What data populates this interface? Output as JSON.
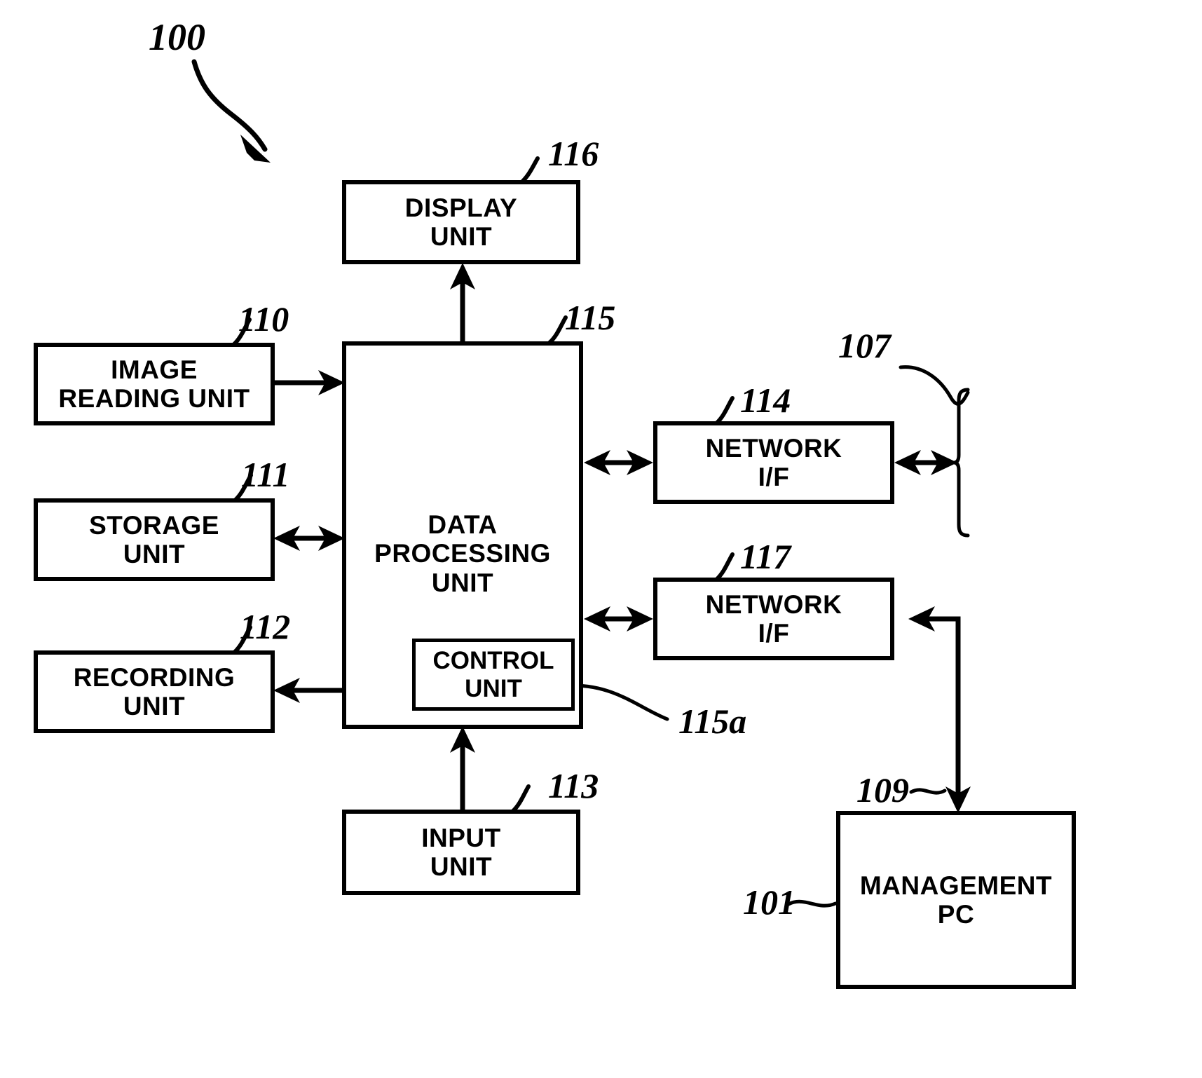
{
  "figure": {
    "type": "patent-block-diagram",
    "system_reference": "100",
    "boxes": [
      {
        "id": "display-unit",
        "label": "DISPLAY\nUNIT",
        "ref": "116"
      },
      {
        "id": "image-reading-unit",
        "label": "IMAGE\nREADING UNIT",
        "ref": "110"
      },
      {
        "id": "storage-unit",
        "label": "STORAGE\nUNIT",
        "ref": "111"
      },
      {
        "id": "recording-unit",
        "label": "RECORDING\nUNIT",
        "ref": "112"
      },
      {
        "id": "input-unit",
        "label": "INPUT\nUNIT",
        "ref": "113"
      },
      {
        "id": "data-processing-unit",
        "label": "DATA\nPROCESSING\nUNIT",
        "ref": "115"
      },
      {
        "id": "control-unit",
        "label": "CONTROL\nUNIT",
        "ref": "115a"
      },
      {
        "id": "network-if-upper",
        "label": "NETWORK\nI/F",
        "ref": "114"
      },
      {
        "id": "network-if-lower",
        "label": "NETWORK\nI/F",
        "ref": "117"
      },
      {
        "id": "management-pc",
        "label": "MANAGEMENT\nPC",
        "ref": "101"
      }
    ],
    "references": {
      "system": "100",
      "display_unit": "116",
      "image_reading_unit": "110",
      "storage_unit": "111",
      "recording_unit": "112",
      "input_unit": "113",
      "data_processing_unit": "115",
      "control_unit": "115a",
      "network_if_upper": "114",
      "network_if_lower": "117",
      "network_bracket": "107",
      "management_link": "109",
      "management_pc": "101"
    },
    "colors": {
      "stroke": "#000000",
      "fill": "#ffffff",
      "text": "#000000"
    }
  }
}
